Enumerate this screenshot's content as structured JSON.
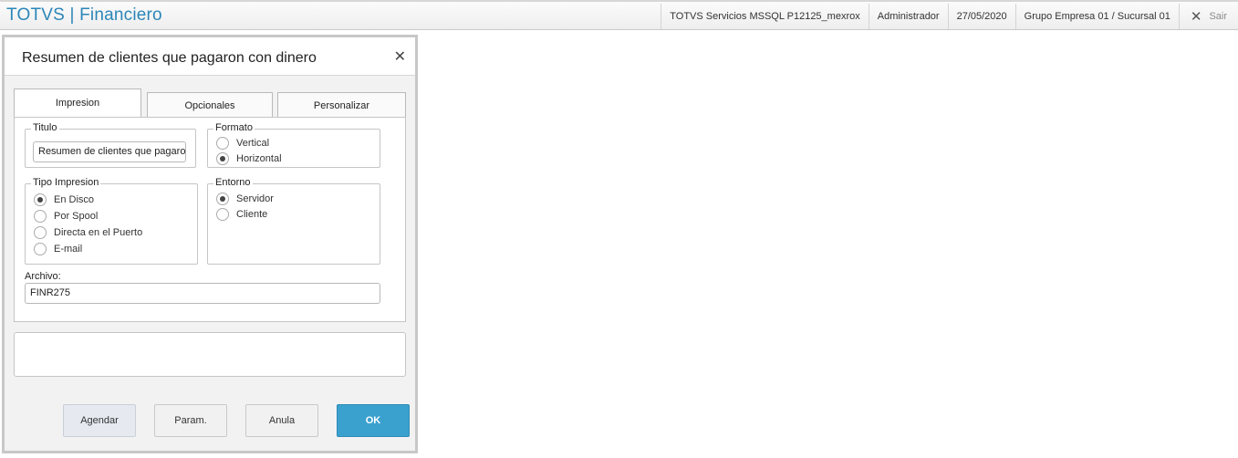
{
  "topbar": {
    "app_title": "TOTVS | Financiero",
    "server": "TOTVS Servicios MSSQL P12125_mexrox",
    "user": "Administrador",
    "date": "27/05/2020",
    "company": "Grupo Empresa 01 / Sucursal 01",
    "exit_label": "Sair"
  },
  "dialog": {
    "title": "Resumen de clientes que pagaron con dinero",
    "tabs": [
      {
        "label": "Impresion",
        "active": true
      },
      {
        "label": "Opcionales",
        "active": false
      },
      {
        "label": "Personalizar",
        "active": false
      }
    ],
    "titulo": {
      "label": "Titulo",
      "value": "Resumen de clientes que pagaron con dinero"
    },
    "formato": {
      "label": "Formato",
      "options": [
        "Vertical",
        "Horizontal"
      ],
      "selected": "Horizontal"
    },
    "tipo_impresion": {
      "label": "Tipo Impresion",
      "options": [
        "En Disco",
        "Por Spool",
        "Directa en el Puerto",
        "E-mail"
      ],
      "selected": "En Disco"
    },
    "entorno": {
      "label": "Entorno",
      "options": [
        "Servidor",
        "Cliente"
      ],
      "selected": "Servidor"
    },
    "archivo": {
      "label": "Archivo:",
      "value": "FINR275"
    },
    "buttons": {
      "agendar": "Agendar",
      "param": "Param.",
      "anula": "Anula",
      "ok": "OK"
    }
  }
}
